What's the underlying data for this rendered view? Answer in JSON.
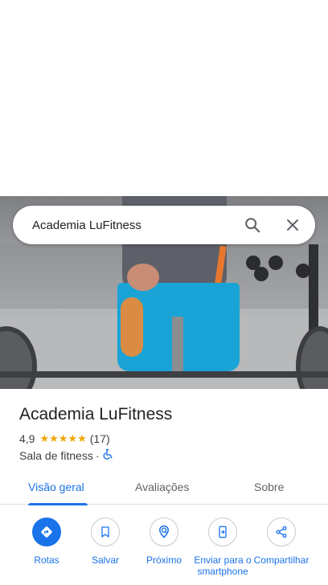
{
  "search": {
    "query": "Academia LuFitness"
  },
  "place": {
    "name": "Academia LuFitness",
    "rating": "4,9",
    "stars": 5,
    "review_count": "(17)",
    "category": "Sala de fitness",
    "separator": "·"
  },
  "tabs": [
    {
      "label": "Visão geral",
      "active": true
    },
    {
      "label": "Avaliações",
      "active": false
    },
    {
      "label": "Sobre",
      "active": false
    }
  ],
  "actions": [
    {
      "label": "Rotas",
      "icon": "directions-icon"
    },
    {
      "label": "Salvar",
      "icon": "bookmark-icon"
    },
    {
      "label": "Próximo",
      "icon": "nearby-icon"
    },
    {
      "label": "Enviar para o smartphone",
      "icon": "send-to-phone-icon"
    },
    {
      "label": "Compartilhar",
      "icon": "share-icon"
    }
  ],
  "colors": {
    "accent": "#1a73e8",
    "star": "#f2a600",
    "text": "#202124",
    "secondary": "#5f6368"
  }
}
